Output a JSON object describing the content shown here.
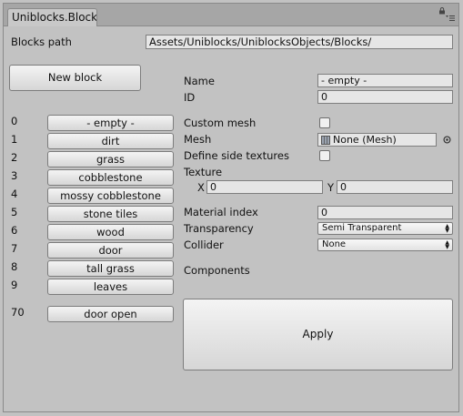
{
  "tab": {
    "title": "Uniblocks.Block"
  },
  "blocks_path": {
    "label": "Blocks path",
    "value": "Assets/Uniblocks/UniblocksObjects/Blocks/"
  },
  "new_block_label": "New block",
  "block_list": [
    {
      "index": "0",
      "name": "- empty -"
    },
    {
      "index": "1",
      "name": "dirt"
    },
    {
      "index": "2",
      "name": "grass"
    },
    {
      "index": "3",
      "name": "cobblestone"
    },
    {
      "index": "4",
      "name": "mossy cobblestone"
    },
    {
      "index": "5",
      "name": "stone tiles"
    },
    {
      "index": "6",
      "name": "wood"
    },
    {
      "index": "7",
      "name": "door"
    },
    {
      "index": "8",
      "name": "tall grass"
    },
    {
      "index": "9",
      "name": "leaves"
    },
    {
      "index": "70",
      "name": "door open"
    }
  ],
  "inspector": {
    "name_label": "Name",
    "name_value": "- empty -",
    "id_label": "ID",
    "id_value": "0",
    "custom_mesh_label": "Custom mesh",
    "mesh_label": "Mesh",
    "mesh_value": "None (Mesh)",
    "define_side_label": "Define side textures",
    "texture_label": "Texture",
    "texture_x_label": "X",
    "texture_x_value": "0",
    "texture_y_label": "Y",
    "texture_y_value": "0",
    "material_index_label": "Material index",
    "material_index_value": "0",
    "transparency_label": "Transparency",
    "transparency_value": "Semi Transparent",
    "collider_label": "Collider",
    "collider_value": "None",
    "components_label": "Components",
    "apply_label": "Apply"
  }
}
